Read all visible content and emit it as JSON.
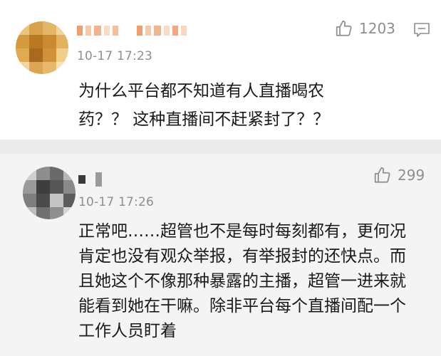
{
  "comments": [
    {
      "time": "10-17 17:23",
      "likes": "1203",
      "text_lines": [
        "为什么平台都不知道有人直播喝农",
        "药？？ 这种直播间不赶紧封了？？"
      ]
    },
    {
      "time": "10-17 17:26",
      "likes": "299",
      "text_lines": [
        "正常吧……超管也不是每时每刻都有，更何况",
        "肯定也没有观众举报，有举报封的还快点。而",
        "且她这个不像那种暴露的主播，超管一进来就",
        "能看到她在干嘛。除非平台每个直播间配一个",
        "工作人员盯着"
      ]
    }
  ],
  "icons": {
    "like": "thumbs-up-icon",
    "reply": "comment-bubble-icon"
  },
  "colors": {
    "meta_text": "#8e8e8e",
    "body_text": "#1a1a1a",
    "card_bg": "#ffffff",
    "page_bg": "#f4f4f4"
  }
}
